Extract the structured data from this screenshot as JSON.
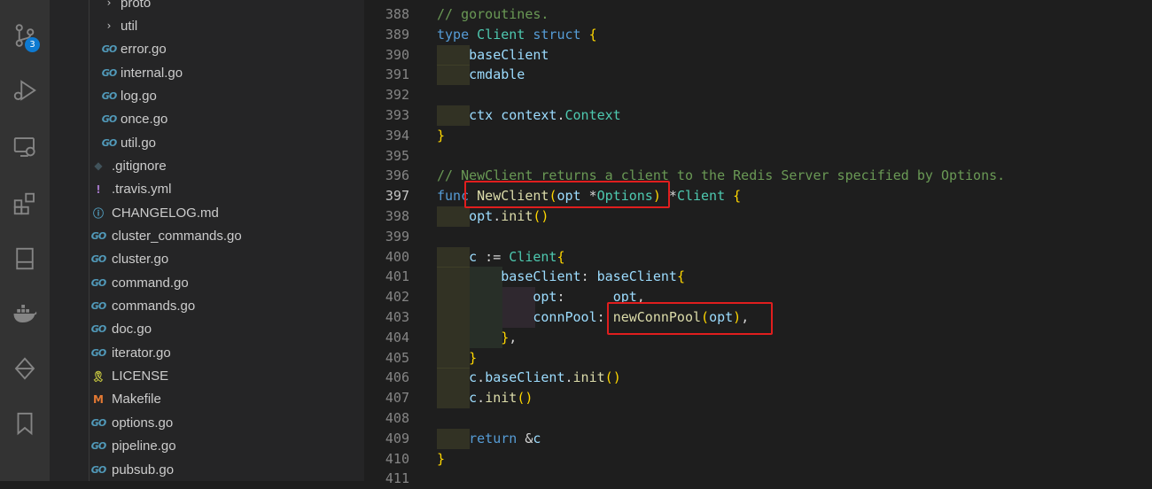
{
  "activity_bar": {
    "icons": [
      "source-control-icon",
      "run-debug-icon",
      "remote-explorer-icon",
      "extensions-icon",
      "book-icon",
      "docker-icon",
      "git-graph-icon",
      "bookmark-icon"
    ],
    "scm_badge": "3"
  },
  "sidebar": {
    "items": [
      {
        "label": "proto",
        "icon": "chevron-right",
        "kind": "folder"
      },
      {
        "label": "util",
        "icon": "chevron-right",
        "kind": "folder"
      },
      {
        "label": "error.go",
        "icon": "GO",
        "kind": "go"
      },
      {
        "label": "internal.go",
        "icon": "GO",
        "kind": "go"
      },
      {
        "label": "log.go",
        "icon": "GO",
        "kind": "go"
      },
      {
        "label": "once.go",
        "icon": "GO",
        "kind": "go"
      },
      {
        "label": "util.go",
        "icon": "GO",
        "kind": "go"
      },
      {
        "label": ".gitignore",
        "icon": "◆",
        "kind": "git"
      },
      {
        "label": ".travis.yml",
        "icon": "!",
        "kind": "yml"
      },
      {
        "label": "CHANGELOG.md",
        "icon": "ⓘ",
        "kind": "md"
      },
      {
        "label": "cluster_commands.go",
        "icon": "GO",
        "kind": "go"
      },
      {
        "label": "cluster.go",
        "icon": "GO",
        "kind": "go"
      },
      {
        "label": "command.go",
        "icon": "GO",
        "kind": "go"
      },
      {
        "label": "commands.go",
        "icon": "GO",
        "kind": "go"
      },
      {
        "label": "doc.go",
        "icon": "GO",
        "kind": "go"
      },
      {
        "label": "iterator.go",
        "icon": "GO",
        "kind": "go"
      },
      {
        "label": "LICENSE",
        "icon": "🎗",
        "kind": "license"
      },
      {
        "label": "Makefile",
        "icon": "M",
        "kind": "make"
      },
      {
        "label": "options.go",
        "icon": "GO",
        "kind": "go"
      },
      {
        "label": "pipeline.go",
        "icon": "GO",
        "kind": "go"
      },
      {
        "label": "pubsub.go",
        "icon": "GO",
        "kind": "go"
      }
    ]
  },
  "editor": {
    "lines": [
      {
        "num": "388",
        "text": "// goroutines."
      },
      {
        "num": "389",
        "text": "type Client struct {"
      },
      {
        "num": "390",
        "text": "    baseClient"
      },
      {
        "num": "391",
        "text": "    cmdable"
      },
      {
        "num": "392",
        "text": ""
      },
      {
        "num": "393",
        "text": "    ctx context.Context"
      },
      {
        "num": "394",
        "text": "}"
      },
      {
        "num": "395",
        "text": ""
      },
      {
        "num": "396",
        "text": "// NewClient returns a client to the Redis Server specified by Options."
      },
      {
        "num": "397",
        "text": "func NewClient(opt *Options) *Client {"
      },
      {
        "num": "398",
        "text": "    opt.init()"
      },
      {
        "num": "399",
        "text": ""
      },
      {
        "num": "400",
        "text": "    c := Client{"
      },
      {
        "num": "401",
        "text": "        baseClient: baseClient{"
      },
      {
        "num": "402",
        "text": "            opt:      opt,"
      },
      {
        "num": "403",
        "text": "            connPool: newConnPool(opt),"
      },
      {
        "num": "404",
        "text": "        },"
      },
      {
        "num": "405",
        "text": "    }"
      },
      {
        "num": "406",
        "text": "    c.baseClient.init()"
      },
      {
        "num": "407",
        "text": "    c.init()"
      },
      {
        "num": "408",
        "text": ""
      },
      {
        "num": "409",
        "text": "    return &c"
      },
      {
        "num": "410",
        "text": "}"
      },
      {
        "num": "411",
        "text": ""
      }
    ],
    "active_line": "397"
  },
  "colors": {
    "keyword": "#569cd6",
    "type": "#4ec9b0",
    "function": "#dcdcaa",
    "comment": "#6a9955",
    "variable": "#9cdcfe",
    "highlight_box": "#e01e1e"
  }
}
